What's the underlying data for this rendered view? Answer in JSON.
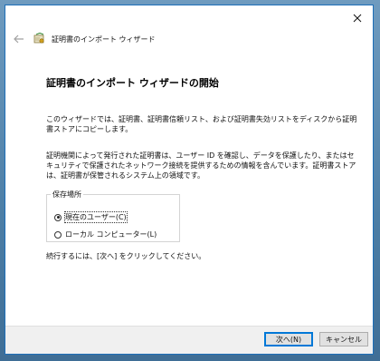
{
  "window": {
    "close_label": "✕"
  },
  "header": {
    "wizard_title": "証明書のインポート ウィザード"
  },
  "main": {
    "title": "証明書のインポート ウィザードの開始",
    "paragraph1": "このウィザードでは、証明書、証明書信頼リスト、および証明書失効リストをディスクから証明書ストアにコピーします。",
    "paragraph2": "証明機関によって発行された証明書は、ユーザー ID を確認し、データを保護したり、またはセキュリティで保護されたネットワーク接続を提供するための情報を含んでいます。証明書ストアは、証明書が保管されるシステム上の領域です。",
    "store_location": {
      "legend": "保存場所",
      "options": [
        {
          "label": "現在のユーザー(C)",
          "checked": true
        },
        {
          "label": "ローカル コンピューター(L)",
          "checked": false
        }
      ]
    },
    "continue_text": "続行するには、[次へ] をクリックしてください。"
  },
  "footer": {
    "next_label": "次へ(N)",
    "cancel_label": "キャンセル"
  }
}
